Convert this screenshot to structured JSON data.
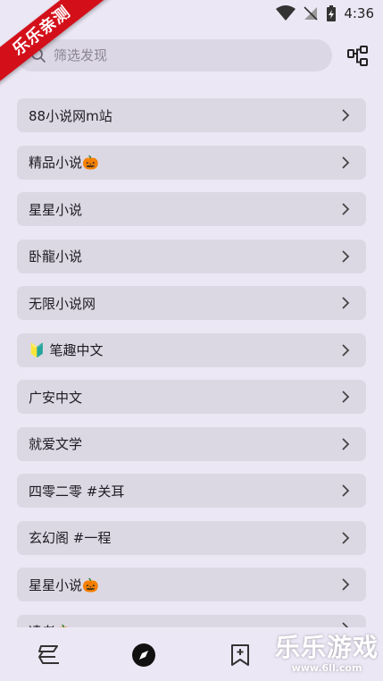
{
  "status_bar": {
    "time": "4:36"
  },
  "ribbon": {
    "text": "乐乐亲测"
  },
  "search": {
    "placeholder": "筛选发现"
  },
  "list": [
    {
      "label": "88小说网m站"
    },
    {
      "label": "精品小说🎃"
    },
    {
      "label": "星星小说"
    },
    {
      "label": "卧龍小说"
    },
    {
      "label": "无限小说网"
    },
    {
      "label": "🔰 笔趣中文"
    },
    {
      "label": "广安中文"
    },
    {
      "label": "就爱文学"
    },
    {
      "label": "四零二零 #关耳"
    },
    {
      "label": "玄幻阁 #一程"
    },
    {
      "label": "星星小说🎃"
    },
    {
      "label": "凌老🎃"
    }
  ],
  "watermark": {
    "title": "乐乐游戏",
    "url": "www.6ll.com"
  },
  "colors": {
    "background": "#ece7f5",
    "item_bg": "#dcd8e3",
    "ribbon": "#d3101a"
  }
}
